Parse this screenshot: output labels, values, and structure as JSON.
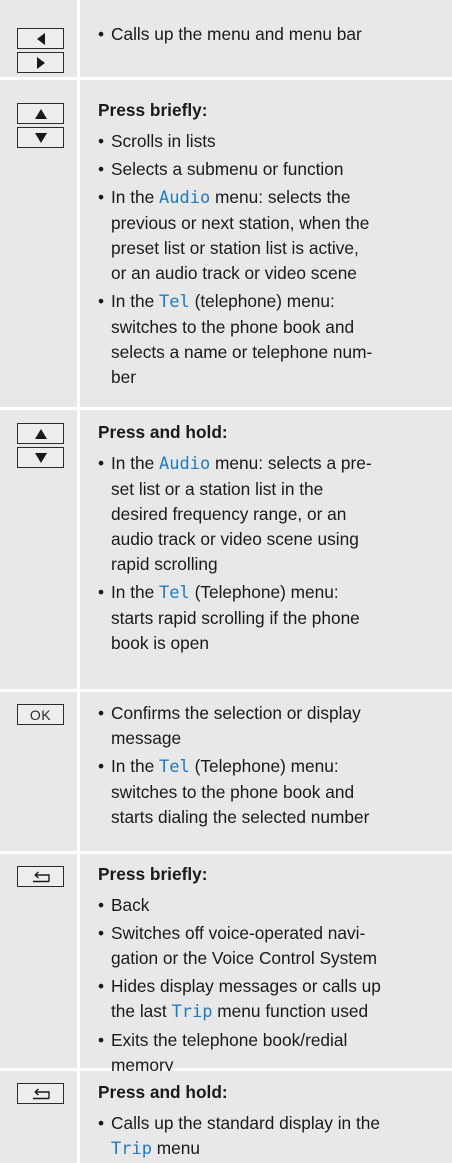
{
  "rows": [
    {
      "keys": [
        "left-arrow",
        "right-arrow"
      ],
      "heading": "",
      "bullets": [
        [
          "Calls up the menu and menu bar"
        ]
      ]
    },
    {
      "keys": [
        "up-arrow",
        "down-arrow"
      ],
      "heading": "Press briefly:",
      "bullets": [
        [
          "Scrolls in lists"
        ],
        [
          "Selects a submenu or function"
        ],
        [
          "In the ",
          {
            "kw": "Audio"
          },
          " menu: selects the previous or next station, when the preset list or station list is active, or an audio track or video scene"
        ],
        [
          "In the ",
          {
            "kw": "Tel"
          },
          " (telephone) menu: switches to the phone book and selects a name or telephone number"
        ]
      ]
    },
    {
      "keys": [
        "up-arrow",
        "down-arrow"
      ],
      "heading": "Press and hold:",
      "bullets": [
        [
          "In the ",
          {
            "kw": "Audio"
          },
          " menu: selects a preset list or a station list in the desired frequency range, or an audio track or video scene using rapid scrolling"
        ],
        [
          "In the ",
          {
            "kw": "Tel"
          },
          " (Telephone) menu: starts rapid scrolling if the phone book is open"
        ]
      ]
    },
    {
      "keys": [
        "ok"
      ],
      "key_label": "OK",
      "heading": "",
      "bullets": [
        [
          "Confirms the selection or display message"
        ],
        [
          "In the ",
          {
            "kw": "Tel"
          },
          " (Telephone) menu: switches to the phone book and starts dialing the selected number"
        ]
      ]
    },
    {
      "keys": [
        "back"
      ],
      "heading": "Press briefly:",
      "bullets": [
        [
          "Back"
        ],
        [
          "Switches off voice-operated navigation or the Voice Control System"
        ],
        [
          "Hides display messages or calls up the last ",
          {
            "kw": "Trip"
          },
          " menu function used"
        ],
        [
          "Exits the telephone book/redial memory"
        ]
      ]
    },
    {
      "keys": [
        "back"
      ],
      "heading": "Press and hold:",
      "bullets": [
        [
          "Calls up the standard display in the ",
          {
            "kw": "Trip"
          },
          " menu"
        ]
      ]
    }
  ]
}
